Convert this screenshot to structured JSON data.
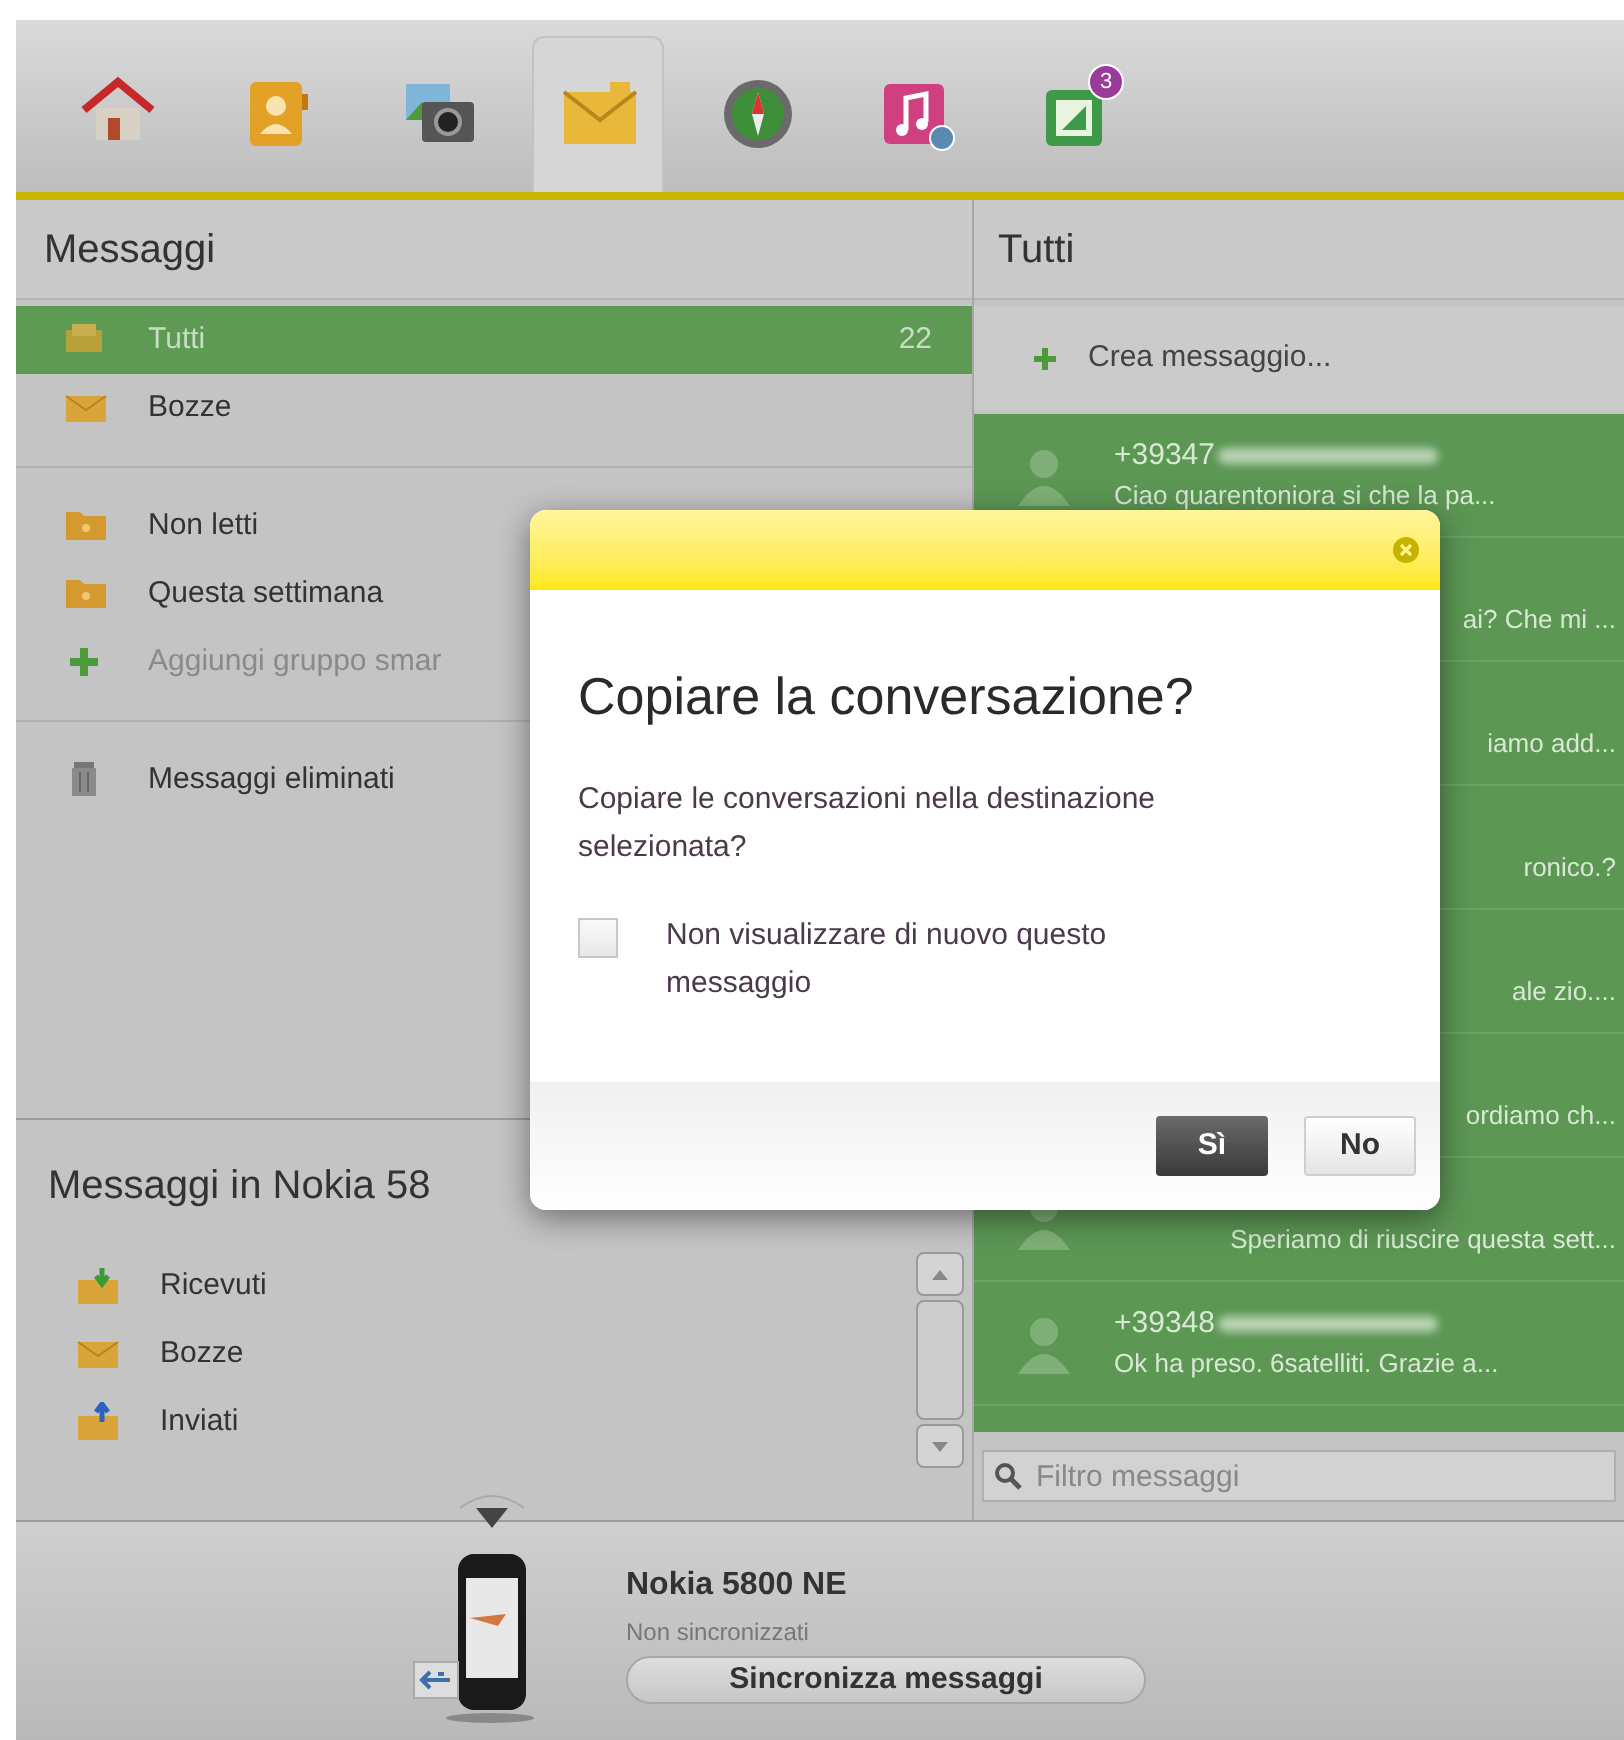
{
  "toolbar": {
    "tabs": [
      {
        "kind": "home",
        "selected": false
      },
      {
        "kind": "contacts",
        "selected": false
      },
      {
        "kind": "photos",
        "selected": false
      },
      {
        "kind": "messages",
        "selected": true
      },
      {
        "kind": "maps",
        "selected": false
      },
      {
        "kind": "music",
        "selected": false
      },
      {
        "kind": "apps",
        "selected": false,
        "badge": "3"
      }
    ]
  },
  "folders": {
    "title": "Messaggi",
    "groups": [
      {
        "items": [
          {
            "kind": "all",
            "label": "Tutti",
            "count": "22",
            "selected": true
          },
          {
            "kind": "drafts",
            "label": "Bozze",
            "selected": false
          }
        ]
      },
      {
        "items": [
          {
            "kind": "smart",
            "label": "Non letti",
            "selected": false
          },
          {
            "kind": "smart",
            "label": "Questa settimana",
            "selected": false
          },
          {
            "kind": "add",
            "label": "Aggiungi gruppo smar",
            "selected": false
          }
        ]
      },
      {
        "items": [
          {
            "kind": "trash",
            "label": "Messaggi eliminati",
            "selected": false
          }
        ]
      }
    ]
  },
  "device_folders": {
    "title": "Messaggi in Nokia 58",
    "items": [
      {
        "kind": "received",
        "label": "Ricevuti"
      },
      {
        "kind": "drafts",
        "label": "Bozze"
      },
      {
        "kind": "sent",
        "label": "Inviati"
      }
    ]
  },
  "messages": {
    "title": "Tutti",
    "compose": "Crea messaggio...",
    "items": [
      {
        "sender": "+39347",
        "blurred": true,
        "preview": "Ciao quarentoniora si che la pa..."
      },
      {
        "preview": "ai? Che mi ..."
      },
      {
        "preview": "iamo add..."
      },
      {
        "preview": "ronico.?"
      },
      {
        "preview": "ale zio...."
      },
      {
        "preview": "ordiamo ch..."
      },
      {
        "preview": "Speriamo di riuscire questa sett..."
      },
      {
        "sender": "+39348",
        "blurred": true,
        "preview": "Ok ha preso. 6satelliti. Grazie a..."
      }
    ],
    "filter": {
      "placeholder": "Filtro messaggi"
    }
  },
  "device": {
    "name": "Nokia 5800 NE",
    "status": "Non sincronizzati",
    "sync_button": "Sincronizza messaggi"
  },
  "dialog": {
    "title": "Copiare la conversazione?",
    "text": "Copiare le conversazioni nella destinazione selezionata?",
    "checkbox": {
      "label": "Non visualizzare di nuovo questo messaggio",
      "checked": false
    },
    "buttons": [
      {
        "label": "Sì",
        "primary": true
      },
      {
        "label": "No",
        "primary": false
      }
    ]
  }
}
